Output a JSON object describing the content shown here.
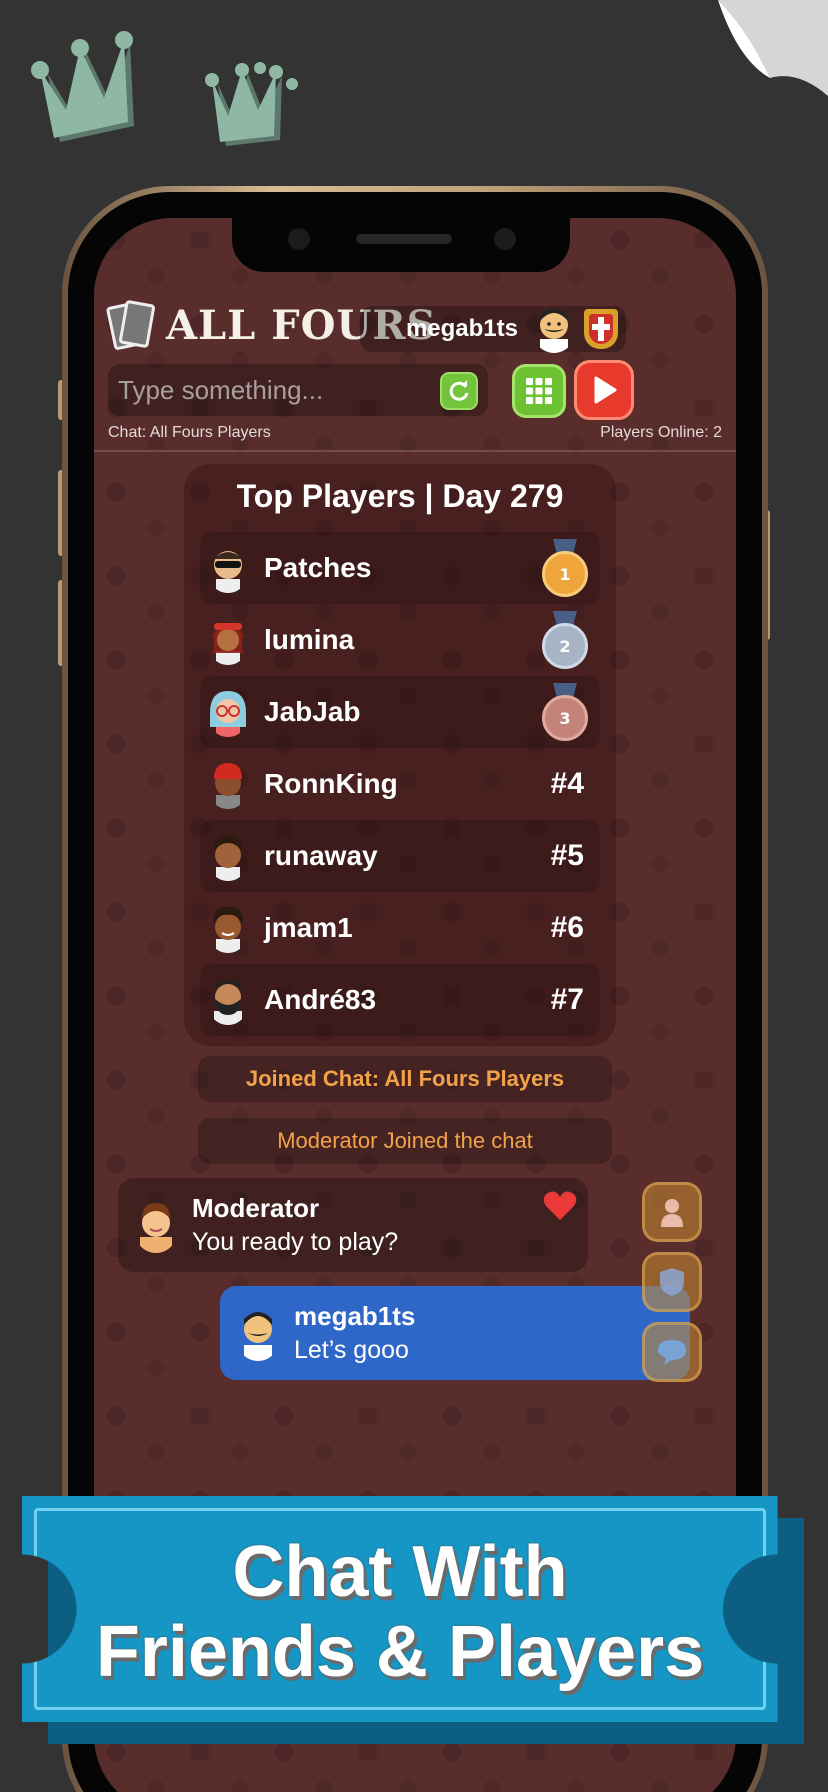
{
  "app": {
    "title": "ALL FOURS",
    "username": "megab1ts",
    "colors": {
      "background": "#333333",
      "screen": "#5a2d2d",
      "accent_orange": "#f2a34a",
      "my_bubble": "#2f67c9",
      "banner": "#1596c4"
    }
  },
  "chat_input": {
    "placeholder": "Type something..."
  },
  "status": {
    "chat_label": "Chat: All Fours Players",
    "players_online": "Players Online: 2"
  },
  "leaderboard": {
    "title": "Top Players  |  Day 279",
    "rows": [
      {
        "name": "Patches",
        "rank": "1",
        "medal": "gold"
      },
      {
        "name": "lumina",
        "rank": "2",
        "medal": "silver"
      },
      {
        "name": "JabJab",
        "rank": "3",
        "medal": "bronze"
      },
      {
        "name": "RonnKing",
        "rank": "#4"
      },
      {
        "name": "runaway",
        "rank": "#5"
      },
      {
        "name": "jmam1",
        "rank": "#6"
      },
      {
        "name": "André83",
        "rank": "#7"
      }
    ]
  },
  "system_messages": [
    "Joined Chat: All Fours Players",
    "Moderator Joined the chat"
  ],
  "messages": [
    {
      "name": "Moderator",
      "text": "You ready to play?",
      "liked": true
    },
    {
      "name": "megab1ts",
      "text": "Let’s gooo"
    }
  ],
  "icons": [
    "refresh-icon",
    "grid-icon",
    "play-icon",
    "heart-icon",
    "profile-icon",
    "shield-icon",
    "chat-bubble-icon",
    "crown-icon"
  ],
  "banner": {
    "line1": "Chat With",
    "line2": "Friends & Players"
  }
}
